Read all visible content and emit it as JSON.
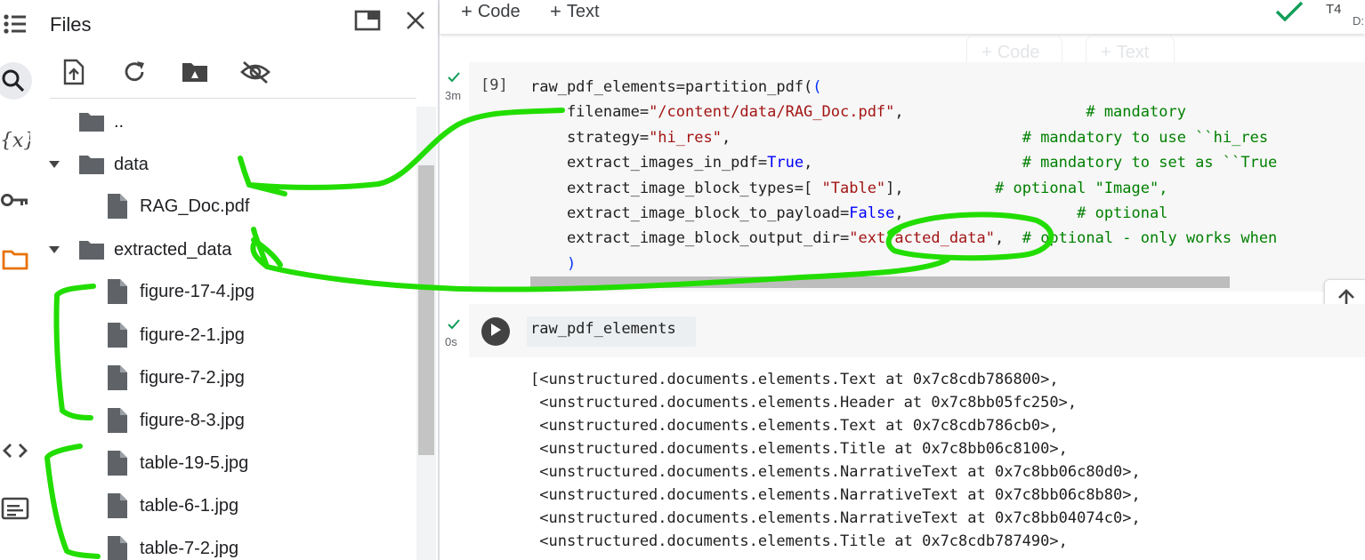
{
  "panel": {
    "title": "Files",
    "tree": [
      {
        "name": "..",
        "kind": "folder-parent"
      },
      {
        "name": "data",
        "kind": "folder-open"
      },
      {
        "name": "RAG_Doc.pdf",
        "kind": "file"
      },
      {
        "name": "extracted_data",
        "kind": "folder-open"
      },
      {
        "name": "figure-17-4.jpg",
        "kind": "file"
      },
      {
        "name": "figure-2-1.jpg",
        "kind": "file"
      },
      {
        "name": "figure-7-2.jpg",
        "kind": "file"
      },
      {
        "name": "figure-8-3.jpg",
        "kind": "file"
      },
      {
        "name": "table-19-5.jpg",
        "kind": "file"
      },
      {
        "name": "table-6-1.jpg",
        "kind": "file"
      },
      {
        "name": "table-7-2.jpg",
        "kind": "file"
      }
    ]
  },
  "toolbar": {
    "code_label": "Code",
    "text_label": "Text",
    "runtime_label": "T4",
    "runtime_sub": "D:"
  },
  "cell1": {
    "exec_count": "[9]",
    "duration": "3m",
    "lines": {
      "l1_a": "raw_pdf_elements=partition_pdf(",
      "l2_a": "    filename=",
      "l2_s": "\"/content/data/RAG_Doc.pdf\"",
      "l2_b": ",                    ",
      "l2_c": "# mandatory",
      "l3_a": "    strategy=",
      "l3_s": "\"hi_res\"",
      "l3_b": ",                                ",
      "l3_c": "# mandatory to use ``hi_res",
      "l4_a": "    extract_images_in_pdf=",
      "l4_k": "True",
      "l4_b": ",                       ",
      "l4_c": "# mandatory to set as ``True",
      "l5_a": "    extract_image_block_types=[ ",
      "l5_s": "\"Table\"",
      "l5_b": "],          ",
      "l5_c": "# optional \"Image\",",
      "l6_a": "    extract_image_block_to_payload=",
      "l6_k": "False",
      "l6_b": ",                   ",
      "l6_c": "# optional",
      "l7_a": "    extract_image_block_output_dir=",
      "l7_s": "\"extracted_data\"",
      "l7_b": ",  ",
      "l7_c": "# optional - only works when",
      "l8_a": "    )"
    }
  },
  "cell2": {
    "duration": "0s",
    "code": "raw_pdf_elements",
    "output_lines": [
      "[<unstructured.documents.elements.Text at 0x7c8cdb786800>,",
      " <unstructured.documents.elements.Header at 0x7c8bb05fc250>,",
      " <unstructured.documents.elements.Text at 0x7c8cdb786cb0>,",
      " <unstructured.documents.elements.Title at 0x7c8bb06c8100>,",
      " <unstructured.documents.elements.NarrativeText at 0x7c8bb06c80d0>,",
      " <unstructured.documents.elements.NarrativeText at 0x7c8bb06c8b80>,",
      " <unstructured.documents.elements.NarrativeText at 0x7c8bb04074c0>,",
      " <unstructured.documents.elements.Title at 0x7c8cdb787490>,"
    ]
  },
  "colors": {
    "accent_orange": "#e8710a",
    "success_green": "#0f9d58",
    "annotation_green": "#22dd00"
  },
  "icons": [
    "list-icon",
    "search-icon",
    "variables-icon",
    "key-icon",
    "folder-icon",
    "code-snippets-icon",
    "terminal-icon",
    "upload-icon",
    "refresh-icon",
    "drive-icon",
    "hide-icon",
    "window-icon",
    "close-icon",
    "run-icon",
    "arrow-up-icon"
  ]
}
